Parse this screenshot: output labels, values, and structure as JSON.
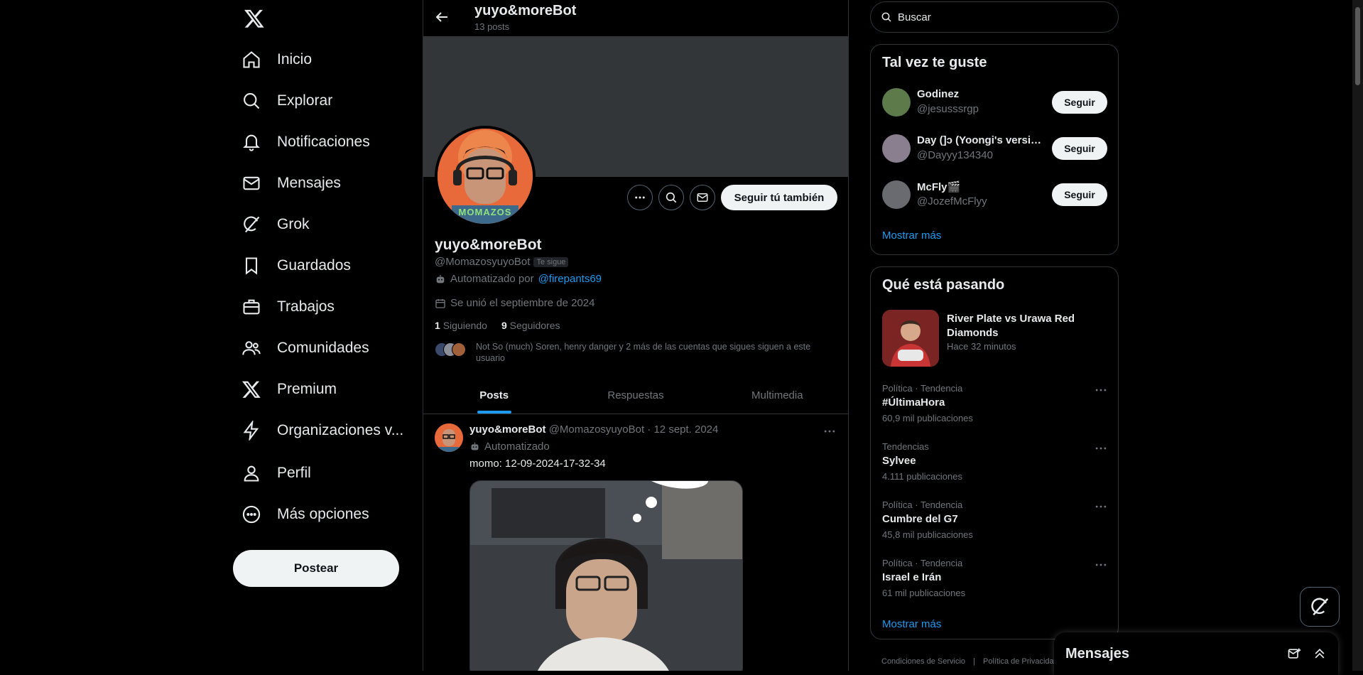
{
  "nav": {
    "items": [
      {
        "label": "Inicio",
        "icon": "home-icon"
      },
      {
        "label": "Explorar",
        "icon": "search-icon"
      },
      {
        "label": "Notificaciones",
        "icon": "bell-icon"
      },
      {
        "label": "Mensajes",
        "icon": "mail-icon"
      },
      {
        "label": "Grok",
        "icon": "grok-icon"
      },
      {
        "label": "Guardados",
        "icon": "bookmark-icon"
      },
      {
        "label": "Trabajos",
        "icon": "briefcase-icon"
      },
      {
        "label": "Comunidades",
        "icon": "people-icon"
      },
      {
        "label": "Premium",
        "icon": "x-logo-icon"
      },
      {
        "label": "Organizaciones v...",
        "icon": "lightning-icon"
      },
      {
        "label": "Perfil",
        "icon": "person-icon"
      },
      {
        "label": "Más opciones",
        "icon": "more-circle-icon"
      }
    ],
    "post_button": "Postear"
  },
  "header": {
    "title": "yuyo&moreBot",
    "subtitle": "13 posts"
  },
  "profile": {
    "avatar_text": "MOMAZOS",
    "follow_button": "Seguir tú también",
    "name": "yuyo&moreBot",
    "handle": "@MomazosyuyoBot",
    "follows_you": "Te sigue",
    "automated_by": "Automatizado por",
    "automated_owner": "@firepants69",
    "joined": "Se unió el septiembre de 2024",
    "following_count": "1",
    "following_label": "Siguiendo",
    "followers_count": "9",
    "followers_label": "Seguidores",
    "followed_by": "Not So (much) Soren, henry danger y 2 más de las cuentas que sigues siguen a este usuario"
  },
  "tabs": [
    "Posts",
    "Respuestas",
    "Multimedia"
  ],
  "tweet": {
    "name": "yuyo&moreBot",
    "meta": "@MomazosyuyoBot · 12 sept. 2024",
    "automated": "Automatizado",
    "text": "momo: 12-09-2024-17-32-34"
  },
  "search": {
    "placeholder": "Buscar"
  },
  "suggestions": {
    "title": "Tal vez te guste",
    "users": [
      {
        "name": "Godinez",
        "handle": "@jesusssrgp",
        "button": "Seguir"
      },
      {
        "name": "Day (]ɔ (Yoongi's versio...",
        "handle": "@Dayyy134340",
        "button": "Seguir"
      },
      {
        "name": "McFly🎬",
        "handle": "@JozefMcFlyy",
        "button": "Seguir"
      }
    ],
    "show_more": "Mostrar más"
  },
  "trending": {
    "title": "Qué está pasando",
    "news": {
      "title": "River Plate vs Urawa Red Diamonds",
      "time": "Hace 32 minutos"
    },
    "items": [
      {
        "category": "Política · Tendencia",
        "name": "#ÚltimaHora",
        "count": "60,9 mil publicaciones"
      },
      {
        "category": "Tendencias",
        "name": "Sylvee",
        "count": "4.111 publicaciones"
      },
      {
        "category": "Política · Tendencia",
        "name": "Cumbre del G7",
        "count": "45,8 mil publicaciones"
      },
      {
        "category": "Política · Tendencia",
        "name": "Israel e Irán",
        "count": "61 mil publicaciones"
      }
    ],
    "show_more": "Mostrar más"
  },
  "footer": {
    "terms": "Condiciones de Servicio",
    "sep": "|",
    "privacy": "Política de Privacidad"
  },
  "messages_dock": {
    "title": "Mensajes"
  },
  "colors": {
    "accent": "#1d9bf0",
    "background": "#000000",
    "border": "#2f3336",
    "muted": "#71767b"
  }
}
